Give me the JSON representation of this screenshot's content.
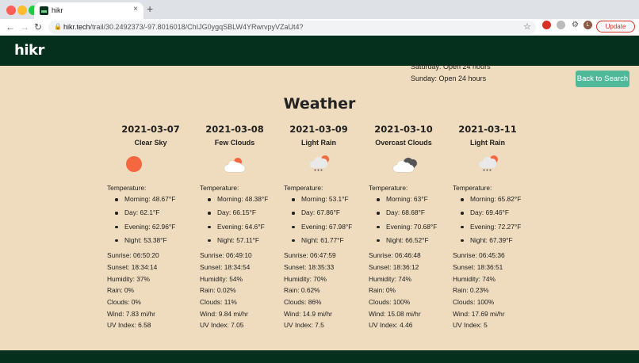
{
  "browser": {
    "tab_title": "hikr",
    "tab_close": "×",
    "new_tab": "+",
    "url_host": "hikr.tech",
    "url_path": "/trail/30.2492373/-97.8016018/ChIJG0ygqSBLW4YRwrvpyVZaUt4?",
    "update_label": "Update",
    "avatar_letter": "L"
  },
  "site": {
    "logo": "hikr",
    "back_label": "Back to Search"
  },
  "hours": {
    "saturday": "Saturday: Open 24 hours",
    "sunday": "Sunday: Open 24 hours"
  },
  "weather": {
    "title": "Weather",
    "temperature_label": "Temperature:",
    "days": [
      {
        "date": "2021-03-07",
        "desc": "Clear Sky",
        "icon": "sun-icon",
        "morning": "Morning: 48.67°F",
        "day": "Day: 62.1°F",
        "evening": "Evening: 62.96°F",
        "night": "Night: 53.38°F",
        "sunrise": "Sunrise: 06:50:20",
        "sunset": "Sunset: 18:34:14",
        "humidity": "Humidity: 37%",
        "rain": "Rain: 0%",
        "clouds": "Clouds: 0%",
        "wind": "Wind: 7.83 mi/hr",
        "uv": "UV Index: 6.58"
      },
      {
        "date": "2021-03-08",
        "desc": "Few Clouds",
        "icon": "partly-cloudy-icon",
        "morning": "Morning: 48.38°F",
        "day": "Day: 66.15°F",
        "evening": "Evening: 64.6°F",
        "night": "Night: 57.11°F",
        "sunrise": "Sunrise: 06:49:10",
        "sunset": "Sunset: 18:34:54",
        "humidity": "Humidity: 54%",
        "rain": "Rain: 0.02%",
        "clouds": "Clouds: 11%",
        "wind": "Wind: 9.84 mi/hr",
        "uv": "UV Index: 7.05"
      },
      {
        "date": "2021-03-09",
        "desc": "Light Rain",
        "icon": "light-rain-icon",
        "morning": "Morning: 53.1°F",
        "day": "Day: 67.86°F",
        "evening": "Evening: 67.98°F",
        "night": "Night: 61.77°F",
        "sunrise": "Sunrise: 06:47:59",
        "sunset": "Sunset: 18:35:33",
        "humidity": "Humidity: 70%",
        "rain": "Rain: 0.62%",
        "clouds": "Clouds: 86%",
        "wind": "Wind: 14.9 mi/hr",
        "uv": "UV Index: 7.5"
      },
      {
        "date": "2021-03-10",
        "desc": "Overcast Clouds",
        "icon": "overcast-clouds-icon",
        "morning": "Morning: 63°F",
        "day": "Day: 68.68°F",
        "evening": "Evening: 70.68°F",
        "night": "Night: 66.52°F",
        "sunrise": "Sunrise: 06:46:48",
        "sunset": "Sunset: 18:36:12",
        "humidity": "Humidity: 74%",
        "rain": "Rain: 0%",
        "clouds": "Clouds: 100%",
        "wind": "Wind: 15.08 mi/hr",
        "uv": "UV Index: 4.46"
      },
      {
        "date": "2021-03-11",
        "desc": "Light Rain",
        "icon": "light-rain-icon",
        "morning": "Morning: 65.82°F",
        "day": "Day: 69.46°F",
        "evening": "Evening: 72.27°F",
        "night": "Night: 67.39°F",
        "sunrise": "Sunrise: 06:45:36",
        "sunset": "Sunset: 18:36:51",
        "humidity": "Humidity: 74%",
        "rain": "Rain: 0.23%",
        "clouds": "Clouds: 100%",
        "wind": "Wind: 17.69 mi/hr",
        "uv": "UV Index: 5"
      }
    ]
  },
  "colors": {
    "header_bg": "#05301d",
    "page_bg": "#efdcbe",
    "accent": "#4fb99a",
    "sun": "#f5673f"
  }
}
